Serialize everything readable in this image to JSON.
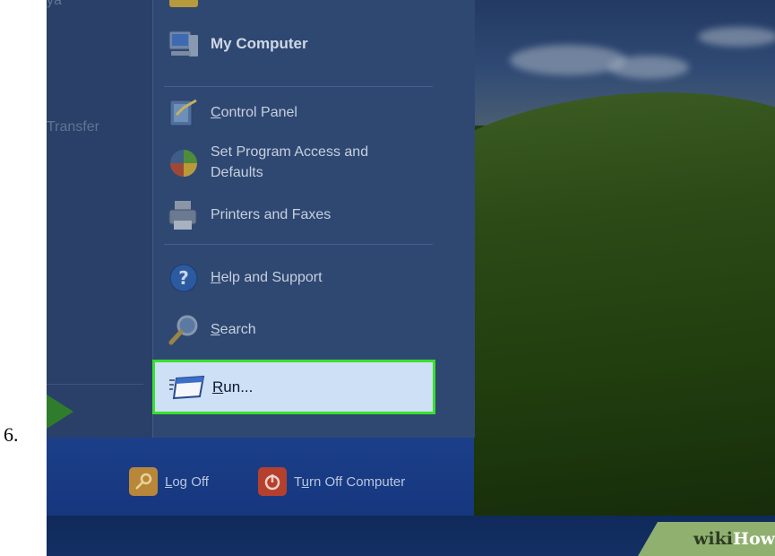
{
  "step": {
    "number": "6."
  },
  "left_pane": {
    "item_partial_top": "ya",
    "item_transfer": "Transfer"
  },
  "right_pane": {
    "my_computer": "My Computer",
    "control_panel": {
      "mnemonic": "C",
      "rest": "ontrol Panel"
    },
    "set_program_access": {
      "line1": "Set Program Access and",
      "line2": "Defaults"
    },
    "printers_faxes": "Printers and Faxes",
    "help_support": {
      "mnemonic": "H",
      "rest": "elp and Support"
    },
    "search": {
      "mnemonic": "S",
      "rest": "earch"
    },
    "run": {
      "mnemonic": "R",
      "rest": "un..."
    }
  },
  "bottom_bar": {
    "log_off": {
      "mnemonic": "L",
      "rest": "og Off"
    },
    "turn_off": {
      "before": "T",
      "mnemonic": "u",
      "rest": "rn Off Computer"
    }
  },
  "watermark": {
    "part1": "wiki",
    "part2": "How"
  },
  "colors": {
    "highlight_border": "#3adf2e",
    "highlight_fill": "#cde0f5",
    "menu_bg": "#2f4872",
    "taskbar": "#132f64",
    "watermark_bg": "#8fb06f"
  }
}
